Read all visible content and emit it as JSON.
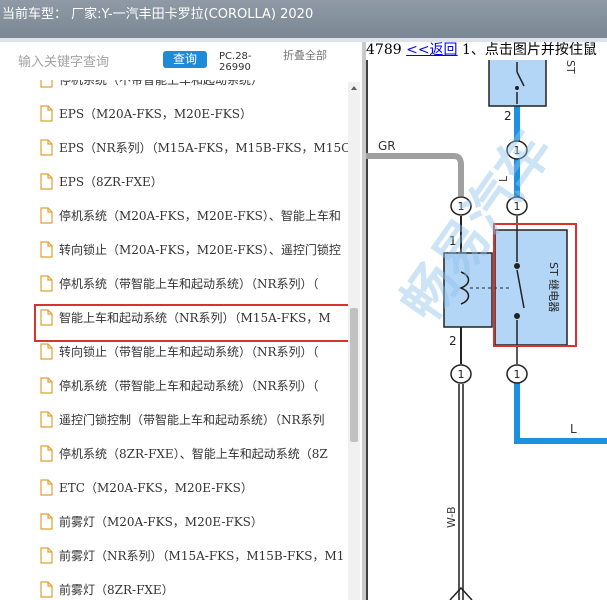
{
  "window": {
    "title": "当前车型：  厂家:Y-一汽丰田卡罗拉(COROLLA) 2020"
  },
  "search": {
    "placeholder": "输入关键字查询",
    "button_label": "查询",
    "pc_code": "PC.28-26990",
    "collapse_label": "折叠全部"
  },
  "tree": {
    "items": [
      {
        "label": "停机系统（不带智能上车和起动系统）"
      },
      {
        "label": "EPS（M20A-FKS，M20E-FKS）"
      },
      {
        "label": "EPS（NR系列）（M15A-FKS，M15B-FKS，M15C"
      },
      {
        "label": "EPS（8ZR-FXE）"
      },
      {
        "label": "停机系统（M20A-FKS，M20E-FKS）、智能上车和"
      },
      {
        "label": "转向锁止（M20A-FKS，M20E-FKS）、遥控门锁控"
      },
      {
        "label": "停机系统（带智能上车和起动系统）（NR系列）（"
      },
      {
        "label": "智能上车和起动系统（NR系列）（M15A-FKS，M"
      },
      {
        "label": "转向锁止（带智能上车和起动系统）（NR系列）（"
      },
      {
        "label": "停机系统（带智能上车和起动系统）（NR系列）（"
      },
      {
        "label": "遥控门锁控制（带智能上车和起动系统）（NR系列"
      },
      {
        "label": "停机系统（8ZR-FXE）、智能上车和起动系统（8Z"
      },
      {
        "label": "ETC（M20A-FKS，M20E-FKS）"
      },
      {
        "label": "前雾灯（M20A-FKS，M20E-FKS）"
      },
      {
        "label": "前雾灯（NR系列）（M15A-FKS，M15B-FKS，M1"
      },
      {
        "label": "前雾灯（8ZR-FXE）"
      }
    ],
    "selected_index": 7
  },
  "document": {
    "code": "4789",
    "back_label": "<<返回",
    "instruction": "1、点击图片并按住鼠"
  },
  "diagram": {
    "wire_labels": {
      "gr": "GR",
      "l_top": "L",
      "l_right": "L",
      "wb": "W-B"
    },
    "connector_label": "1",
    "pin_labels": {
      "top_right_pin": "2",
      "relay_left_top": "1",
      "relay_left_bottom": "2",
      "relay_right_top": "5",
      "relay_right_bottom": "3"
    },
    "relay_name": "ST 继电器",
    "top_box_label": "ST",
    "watermark": "畅易汽车"
  },
  "colors": {
    "title_bar": "#8f9aa6",
    "accent_blue": "#1f8ad8",
    "selection_border": "#d9342b",
    "wire_blue": "#1e90e0",
    "wire_gray": "#a0a0a0",
    "relay_fill": "#b4d6f6"
  },
  "icons": {
    "tree_item": "document-icon"
  }
}
